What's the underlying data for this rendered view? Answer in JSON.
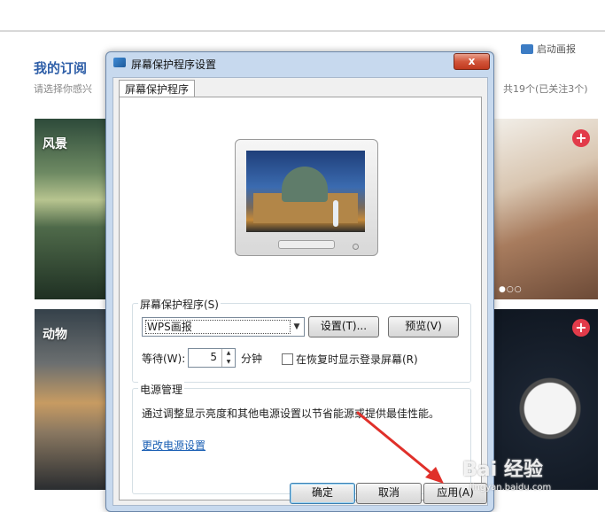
{
  "background": {
    "section_title": "我的订阅",
    "section_subtitle": "请选择你感兴",
    "start_label": "启动画报",
    "count_label": "共19个(已关注3个)",
    "tiles": [
      {
        "label": "风景"
      },
      {
        "label": "动物"
      }
    ],
    "add_icon_glyph": "+"
  },
  "dialog": {
    "title": "屏幕保护程序设置",
    "close_glyph": "x",
    "tab_label": "屏幕保护程序",
    "screensaver_group_label": "屏幕保护程序(S)",
    "screensaver_selected": "WPS画报",
    "combo_arrow": "▼",
    "settings_button": "设置(T)...",
    "preview_button": "预览(V)",
    "wait_label": "等待(W):",
    "wait_value": "5",
    "minutes_label": "分钟",
    "resume_checkbox_label": "在恢复时显示登录屏幕(R)",
    "resume_checked": false,
    "power_group_label": "电源管理",
    "power_description": "通过调整显示亮度和其他电源设置以节省能源或提供最佳性能。",
    "power_link": "更改电源设置",
    "ok_button": "确定",
    "cancel_button": "取消",
    "apply_button": "应用(A)"
  },
  "watermark": {
    "brand": "Bai 经验",
    "url": "jingyan.baidu.com"
  },
  "colors": {
    "accent_link": "#1a5fb4",
    "close_red": "#c0391e",
    "annotation_arrow": "#e0302a",
    "plus_red": "#e23b4a"
  }
}
